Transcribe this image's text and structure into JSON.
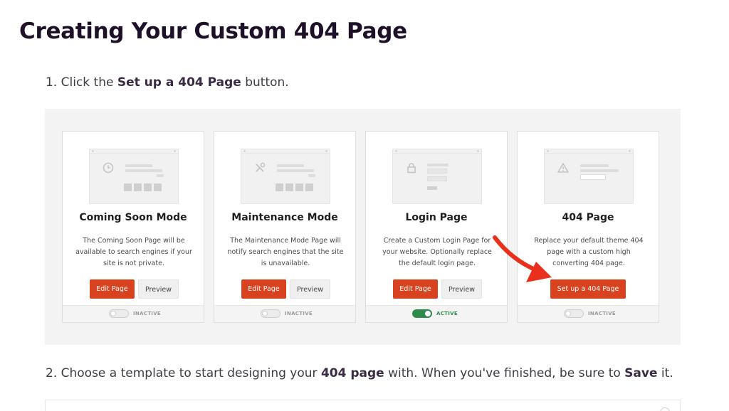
{
  "heading": "Creating Your Custom 404 Page",
  "step1": {
    "prefix": "1. Click the ",
    "bold": "Set up a 404 Page",
    "suffix": " button."
  },
  "cards": [
    {
      "title": "Coming Soon Mode",
      "description": "The Coming Soon Page will be available to search engines if your site is not private.",
      "primary_button": "Edit Page",
      "secondary_button": "Preview",
      "status": "INACTIVE",
      "icon": "clock-icon"
    },
    {
      "title": "Maintenance Mode",
      "description": "The Maintenance Mode Page will notify search engines that the site is unavailable.",
      "primary_button": "Edit Page",
      "secondary_button": "Preview",
      "status": "INACTIVE",
      "icon": "tools-icon"
    },
    {
      "title": "Login Page",
      "description": "Create a Custom Login Page for your website. Optionally replace the default login page.",
      "primary_button": "Edit Page",
      "secondary_button": "Preview",
      "status": "ACTIVE",
      "icon": "lock-icon"
    },
    {
      "title": "404 Page",
      "description": "Replace your default theme 404 page with a custom high converting 404 page.",
      "primary_button": "Set up a 404 Page",
      "status": "INACTIVE",
      "icon": "warning-icon"
    }
  ],
  "step2": {
    "prefix": "2. Choose a template to start designing your ",
    "bold1": "404 page",
    "middle": " with. When you've finished, be sure to ",
    "bold2": "Save",
    "suffix": " it."
  },
  "colors": {
    "primary_button": "#d9421f",
    "active_toggle": "#2f8a4b",
    "arrow": "#e8301c",
    "heading": "#1d1028"
  }
}
